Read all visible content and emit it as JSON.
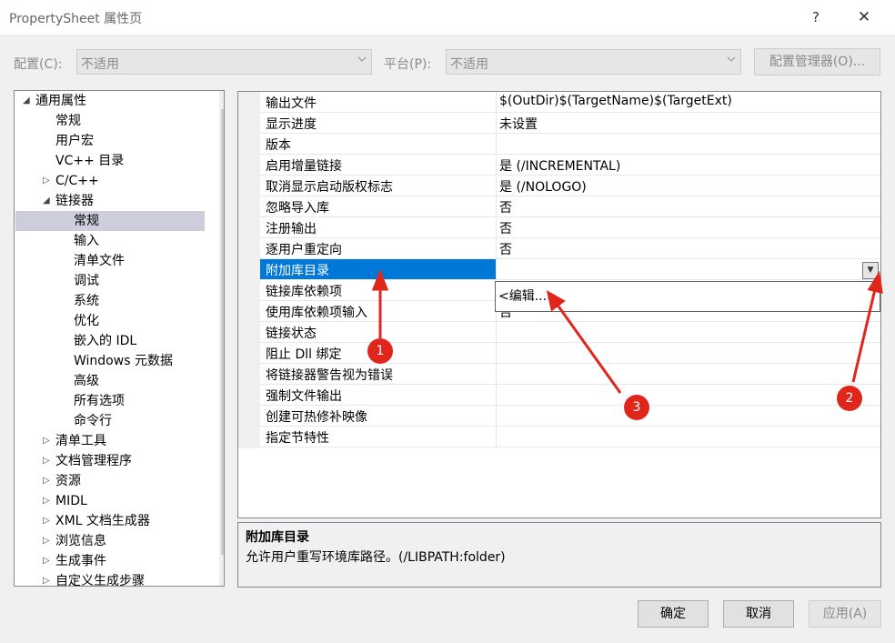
{
  "window": {
    "title": "PropertySheet 属性页",
    "help_label": "?",
    "close_label": "✕"
  },
  "config_bar": {
    "config_label": "配置(C):",
    "config_value": "不适用",
    "platform_label": "平台(P):",
    "platform_value": "不适用",
    "manager_button": "配置管理器(O)..."
  },
  "tree": {
    "items": [
      {
        "label": "通用属性",
        "expander": "◢"
      },
      {
        "label": "常规",
        "expander": ""
      },
      {
        "label": "用户宏",
        "expander": ""
      },
      {
        "label": "VC++ 目录",
        "expander": ""
      },
      {
        "label": "C/C++",
        "expander": "▷"
      },
      {
        "label": "链接器",
        "expander": "◢"
      },
      {
        "label": "常规",
        "expander": ""
      },
      {
        "label": "输入",
        "expander": ""
      },
      {
        "label": "清单文件",
        "expander": ""
      },
      {
        "label": "调试",
        "expander": ""
      },
      {
        "label": "系统",
        "expander": ""
      },
      {
        "label": "优化",
        "expander": ""
      },
      {
        "label": "嵌入的 IDL",
        "expander": ""
      },
      {
        "label": "Windows 元数据",
        "expander": ""
      },
      {
        "label": "高级",
        "expander": ""
      },
      {
        "label": "所有选项",
        "expander": ""
      },
      {
        "label": "命令行",
        "expander": ""
      },
      {
        "label": "清单工具",
        "expander": "▷"
      },
      {
        "label": "文档管理程序",
        "expander": "▷"
      },
      {
        "label": "资源",
        "expander": "▷"
      },
      {
        "label": "MIDL",
        "expander": "▷"
      },
      {
        "label": "XML 文档生成器",
        "expander": "▷"
      },
      {
        "label": "浏览信息",
        "expander": "▷"
      },
      {
        "label": "生成事件",
        "expander": "▷"
      },
      {
        "label": "自定义生成步骤",
        "expander": "▷"
      }
    ],
    "scroll_up": "▲",
    "scroll_down": "▼"
  },
  "grid": {
    "rows": [
      {
        "name": "输出文件",
        "value": "$(OutDir)$(TargetName)$(TargetExt)"
      },
      {
        "name": "显示进度",
        "value": "未设置"
      },
      {
        "name": "版本",
        "value": ""
      },
      {
        "name": "启用增量链接",
        "value": "是 (/INCREMENTAL)"
      },
      {
        "name": "取消显示启动版权标志",
        "value": "是 (/NOLOGO)"
      },
      {
        "name": "忽略导入库",
        "value": "否"
      },
      {
        "name": "注册输出",
        "value": "否"
      },
      {
        "name": "逐用户重定向",
        "value": "否"
      },
      {
        "name": "附加库目录",
        "value": ""
      },
      {
        "name": "链接库依赖项",
        "value": ""
      },
      {
        "name": "使用库依赖项输入",
        "value": "否"
      },
      {
        "name": "链接状态",
        "value": ""
      },
      {
        "name": "阻止 Dll 绑定",
        "value": ""
      },
      {
        "name": "将链接器警告视为错误",
        "value": ""
      },
      {
        "name": "强制文件输出",
        "value": ""
      },
      {
        "name": "创建可热修补映像",
        "value": ""
      },
      {
        "name": "指定节特性",
        "value": ""
      }
    ],
    "dropdown_arrow": "▼",
    "dropdown_item": "<编辑...>"
  },
  "description": {
    "title": "附加库目录",
    "text": "允许用户重写环境库路径。(/LIBPATH:folder)"
  },
  "buttons": {
    "ok": "确定",
    "cancel": "取消",
    "apply": "应用(A)"
  },
  "annotations": {
    "badge_1": "1",
    "badge_2": "2",
    "badge_3": "3",
    "color": "#e0251b"
  }
}
